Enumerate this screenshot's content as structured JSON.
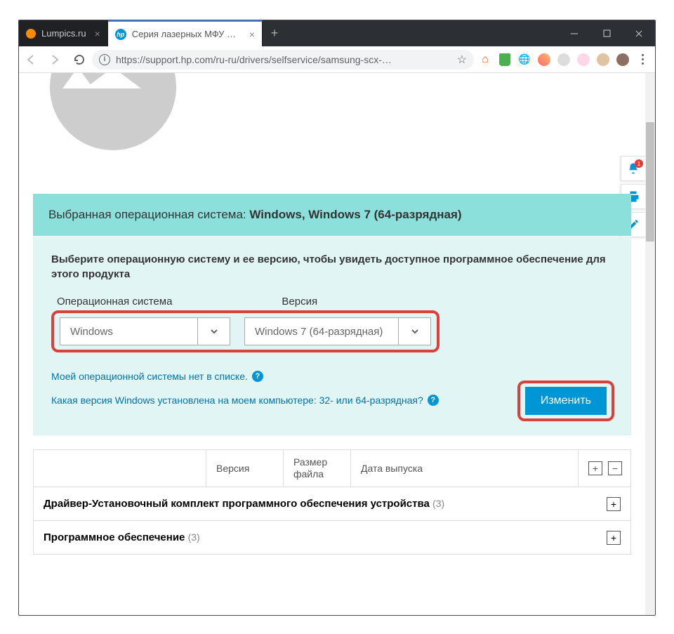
{
  "tabs": [
    {
      "title": "Lumpics.ru",
      "active": false
    },
    {
      "title": "Серия лазерных МФУ Samsung",
      "active": true
    }
  ],
  "url": "https://support.hp.com/ru-ru/drivers/selfservice/samsung-scx-…",
  "osBand": {
    "prefix": "Выбранная операционная система:",
    "value": "Windows, Windows 7 (64-разрядная)"
  },
  "instruct": "Выберите операционную систему и ее версию, чтобы увидеть доступное программное обеспечение для этого продукта",
  "selects": {
    "osLabel": "Операционная система",
    "osValue": "Windows",
    "verLabel": "Версия",
    "verValue": "Windows 7 (64-разрядная)"
  },
  "links": {
    "noOS": "Моей операционной системы нет в списке.",
    "whichVer": "Какая версия Windows установлена на моем компьютере: 32- или 64-разрядная?"
  },
  "changeBtn": "Изменить",
  "tableHead": {
    "version": "Версия",
    "size": "Размер файла",
    "date": "Дата выпуска"
  },
  "categories": [
    {
      "name": "Драйвер-Установочный комплект программного обеспечения устройства",
      "count": "(3)"
    },
    {
      "name": "Программное обеспечение",
      "count": "(3)"
    }
  ],
  "floatBadge": "1"
}
